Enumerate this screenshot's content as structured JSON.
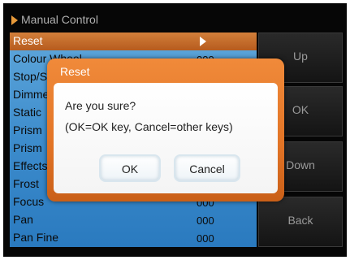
{
  "header": {
    "title": "Manual Control"
  },
  "menu": {
    "items": [
      {
        "label": "Reset",
        "value": "",
        "selected": true
      },
      {
        "label": "Colour Wheel",
        "value": "000"
      },
      {
        "label": "Stop/S",
        "value": ""
      },
      {
        "label": "Dimme",
        "value": ""
      },
      {
        "label": "Static",
        "value": ""
      },
      {
        "label": "Prism",
        "value": ""
      },
      {
        "label": "Prism",
        "value": ""
      },
      {
        "label": "Effects",
        "value": ""
      },
      {
        "label": "Frost",
        "value": ""
      },
      {
        "label": "Focus",
        "value": "000"
      },
      {
        "label": "Pan",
        "value": "000"
      },
      {
        "label": "Pan Fine",
        "value": "000"
      }
    ]
  },
  "side_buttons": {
    "up": "Up",
    "ok": "OK",
    "down": "Down",
    "back": "Back"
  },
  "dialog": {
    "title": "Reset",
    "question": "Are you sure?",
    "hint": "(OK=OK key, Cancel=other keys)",
    "ok_label": "OK",
    "cancel_label": "Cancel"
  },
  "colors": {
    "accent": "#e27426",
    "list_bg": "#3d8ccc",
    "selected_row": "#c56a2a"
  }
}
